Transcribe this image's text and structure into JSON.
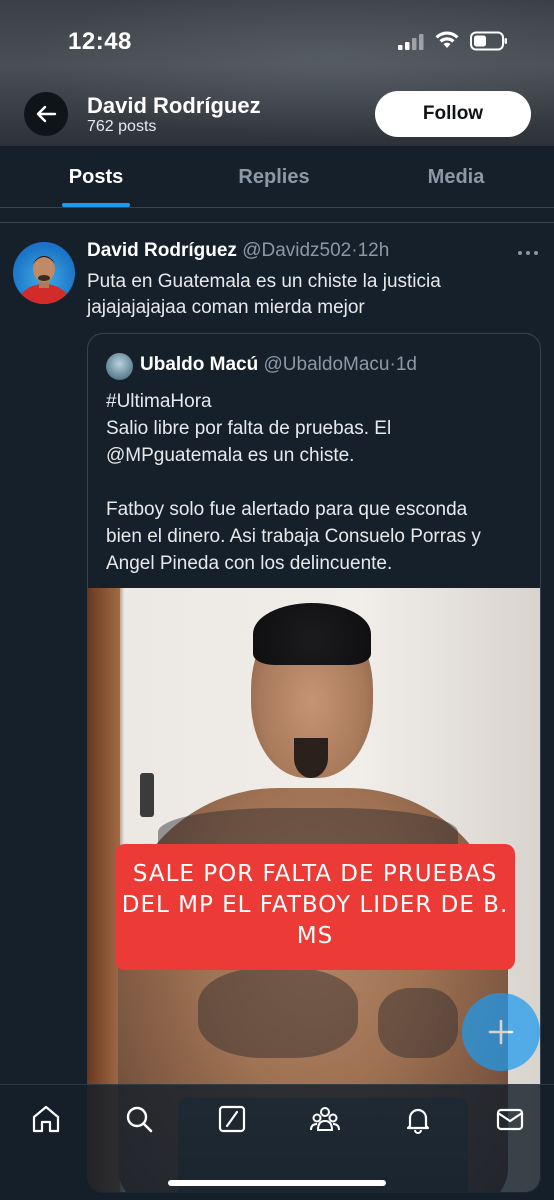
{
  "status_bar": {
    "time": "12:48"
  },
  "profile": {
    "name": "David Rodríguez",
    "post_count": "762 posts",
    "follow_label": "Follow"
  },
  "tabs": [
    {
      "label": "Posts",
      "active": true
    },
    {
      "label": "Replies",
      "active": false
    },
    {
      "label": "Media",
      "active": false
    }
  ],
  "tweet": {
    "author_name": "David Rodríguez",
    "handle": "@Davidz502",
    "time": "12h",
    "text_line1": "Puta en Guatemala es un chiste la justicia",
    "text_line2": "jajajajajajaa coman mierda mejor"
  },
  "quote": {
    "author_name": "Ubaldo Macú",
    "handle": "@UbaldoMacu",
    "time": "1d",
    "lines": [
      "#UltimaHora",
      "Salio libre por falta de pruebas. El",
      "@MPguatemala es un chiste.",
      "Fatboy solo fue alertado para que esconda",
      "bien el dinero. Asi trabaja Consuelo Porras y",
      "Angel Pineda con los delincuente."
    ],
    "image_banner_lines": [
      "SALE POR FALTA DE PRUEBAS",
      "DEL MP EL FATBOY LIDER DE B.",
      "MS"
    ]
  },
  "colors": {
    "background": "#15202b",
    "accent": "#1d9bf0",
    "banner": "#ec3b36",
    "border": "#38444d"
  },
  "bottom_nav": [
    "home-icon",
    "search-icon",
    "grok-icon",
    "communities-icon",
    "notifications-icon",
    "messages-icon"
  ]
}
